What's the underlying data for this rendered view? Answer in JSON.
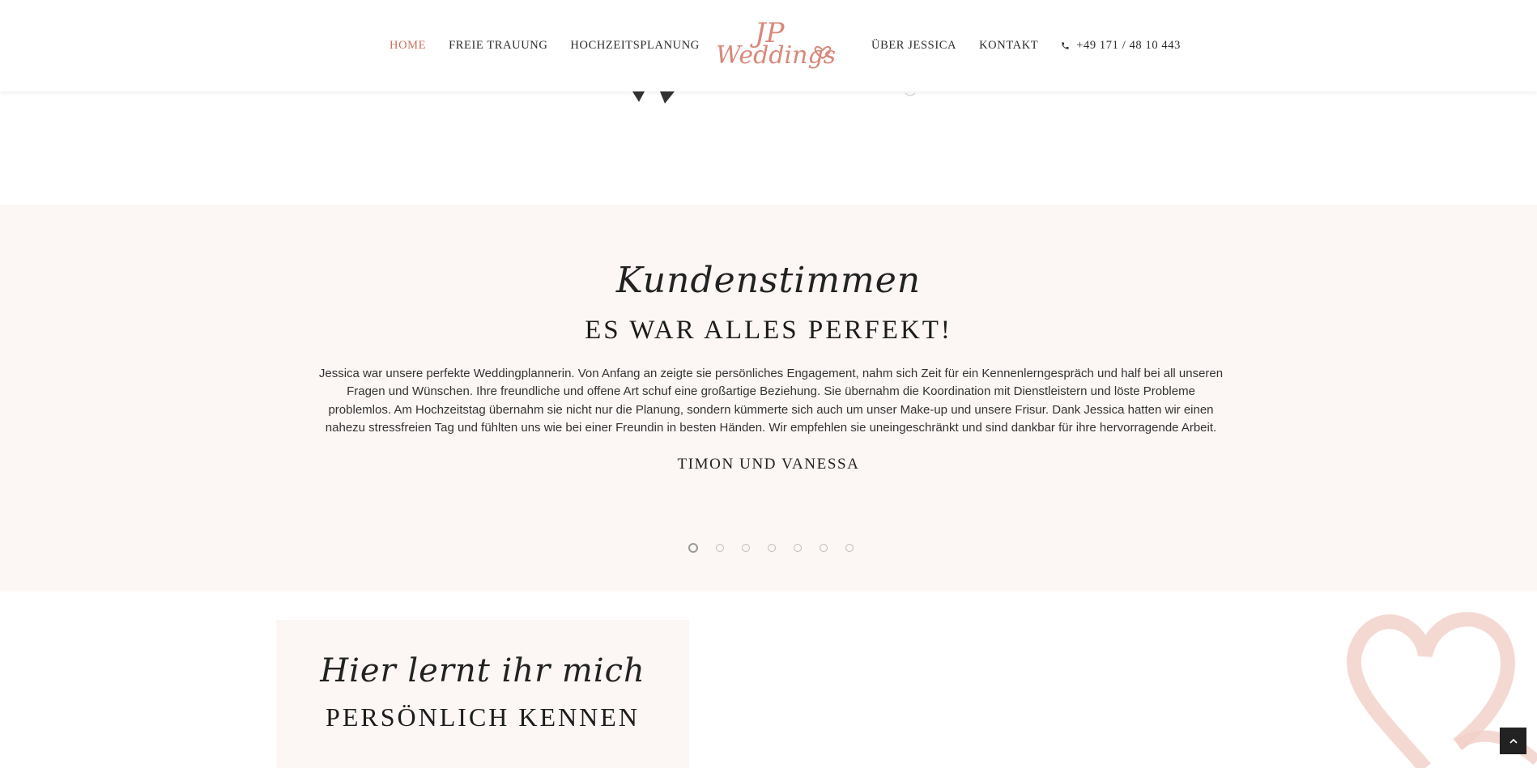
{
  "nav": {
    "home": "HOME",
    "freie_trauung": "FREIE TRAUUNG",
    "hochzeitsplanung": "HOCHZEITSPLANUNG",
    "ueber": "ÜBER JESSICA",
    "kontakt": "KONTAKT",
    "phone": "+49 171 / 48 10 443"
  },
  "logo": {
    "monogram": "JP",
    "wordmark": "Weddings"
  },
  "testimonials": {
    "script_title": "Kundenstimmen",
    "heading": "ES WAR ALLES PERFEKT!",
    "body": "Jessica war unsere perfekte Weddingplannerin. Von Anfang an zeigte sie persönliches Engagement, nahm sich Zeit für ein Kennenlerngespräch und half bei all unseren Fragen und Wünschen. Ihre freundliche und offene Art schuf eine großartige Beziehung. Sie übernahm die Koordination mit Dienstleistern und löste Probleme problemlos. Am Hochzeitstag übernahm sie nicht nur die Planung, sondern kümmerte sich auch um unser Make-up und unsere Frisur. Dank Jessica hatten wir einen nahezu stressfreien Tag und fühlten uns wie bei einer Freundin in besten Händen. Wir empfehlen sie uneingeschränkt und sind dankbar für ihre hervorragende Arbeit.",
    "author": "TIMON UND VANESSA",
    "slide_count": 7,
    "active_slide": 1
  },
  "about": {
    "script_title": "Hier lernt ihr mich",
    "heading": "PERSÖNLICH KENNEN"
  },
  "colors": {
    "accent": "#c9705f",
    "section_bg": "#fcf7f4",
    "logo_pink": "#d9887a"
  },
  "icons": {
    "phone": "phone-icon",
    "scroll_top": "chevron-up-icon"
  }
}
